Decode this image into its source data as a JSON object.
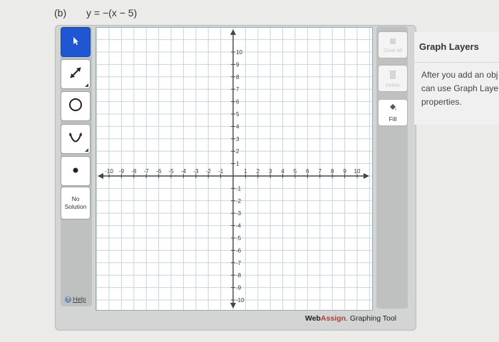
{
  "problem": {
    "part": "(b)",
    "equation": "y = −(x − 5)"
  },
  "toolbar": {
    "tools": [
      {
        "name": "pointer",
        "icon": "pointer-arrow-icon",
        "selected": true
      },
      {
        "name": "line",
        "icon": "line-tool-icon"
      },
      {
        "name": "circle",
        "icon": "circle-tool-icon"
      },
      {
        "name": "parabola",
        "icon": "parabola-tool-icon"
      },
      {
        "name": "point",
        "icon": "point-tool-icon"
      }
    ],
    "no_solution_line1": "No",
    "no_solution_line2": "Solution",
    "help_label": "Help"
  },
  "graph": {
    "xmin": -10,
    "xmax": 10,
    "ymin": -10,
    "ymax": 10,
    "x_ticks": [
      "-10",
      "-9",
      "-8",
      "-7",
      "-6",
      "-5",
      "-4",
      "-3",
      "-2",
      "-1",
      "",
      "1",
      "2",
      "3",
      "4",
      "5",
      "6",
      "7",
      "8",
      "9",
      "10"
    ],
    "y_ticks": [
      "10",
      "9",
      "8",
      "7",
      "6",
      "5",
      "4",
      "3",
      "2",
      "1",
      "",
      "-1",
      "-2",
      "-3",
      "-4",
      "-5",
      "-6",
      "-7",
      "-8",
      "-9",
      "-10"
    ]
  },
  "right_toolbar": {
    "clear_all": "Clear All",
    "delete": "Delete",
    "fill": "Fill"
  },
  "footer": {
    "brand_web": "Web",
    "brand_assign": "Assign",
    "suffix": ". Graphing Tool"
  },
  "layers": {
    "title": "Graph Layers",
    "text": "After you add an obj\ncan use Graph Laye\nproperties."
  }
}
